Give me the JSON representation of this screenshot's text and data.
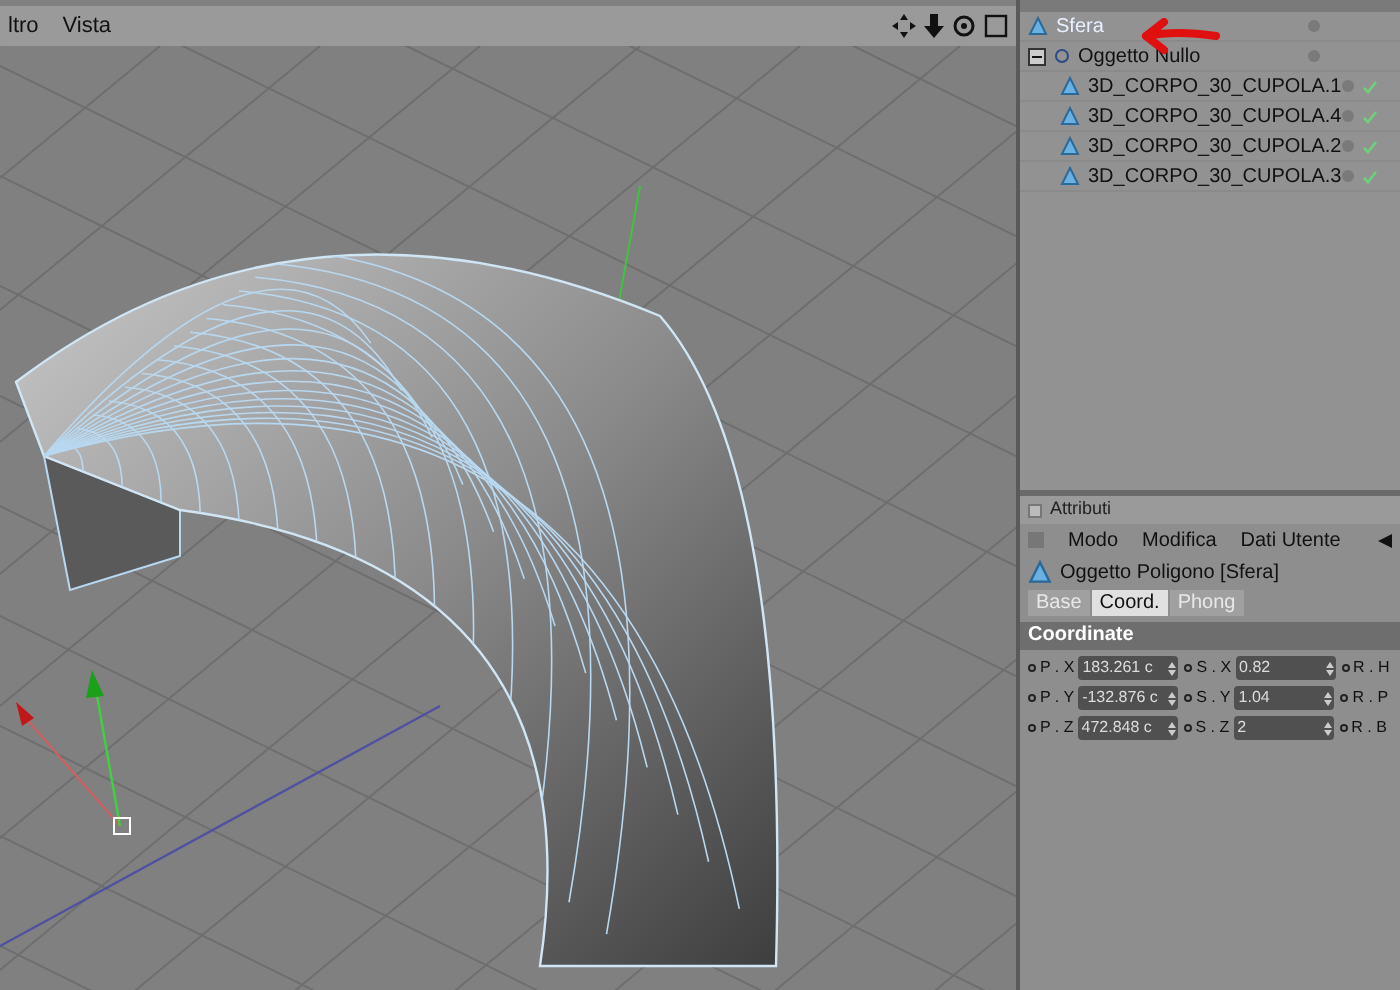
{
  "viewport": {
    "menu": [
      "ltro",
      "Vista"
    ]
  },
  "object_manager": {
    "tree": [
      {
        "name": "Sfera",
        "kind": "polygon",
        "selected": true
      },
      {
        "name": "Oggetto Nullo",
        "kind": "null",
        "selected": false,
        "expanded": true,
        "children": [
          {
            "name": "3D_CORPO_30_CUPOLA.1",
            "kind": "polygon",
            "selected": false,
            "checked": true
          },
          {
            "name": "3D_CORPO_30_CUPOLA.4",
            "kind": "polygon",
            "selected": false,
            "checked": true
          },
          {
            "name": "3D_CORPO_30_CUPOLA.2",
            "kind": "polygon",
            "selected": false,
            "checked": true
          },
          {
            "name": "3D_CORPO_30_CUPOLA.3",
            "kind": "polygon",
            "selected": false,
            "checked": true
          }
        ]
      }
    ]
  },
  "attributes": {
    "title": "Attributi",
    "menu": [
      "Modo",
      "Modifica",
      "Dati Utente"
    ],
    "object_title": "Oggetto Poligono [Sfera]",
    "tabs": [
      {
        "label": "Base",
        "selected": false
      },
      {
        "label": "Coord.",
        "selected": true
      },
      {
        "label": "Phong",
        "selected": false
      }
    ],
    "section": "Coordinate",
    "rows": [
      [
        {
          "label": "P . X",
          "value": "183.261 c"
        },
        {
          "label": "S . X",
          "value": "0.82"
        },
        {
          "label": "R . H"
        }
      ],
      [
        {
          "label": "P . Y",
          "value": "-132.876 c"
        },
        {
          "label": "S . Y",
          "value": "1.04"
        },
        {
          "label": "R . P"
        }
      ],
      [
        {
          "label": "P . Z",
          "value": "472.848 c"
        },
        {
          "label": "S . Z",
          "value": "2"
        },
        {
          "label": "R . B"
        }
      ]
    ]
  }
}
